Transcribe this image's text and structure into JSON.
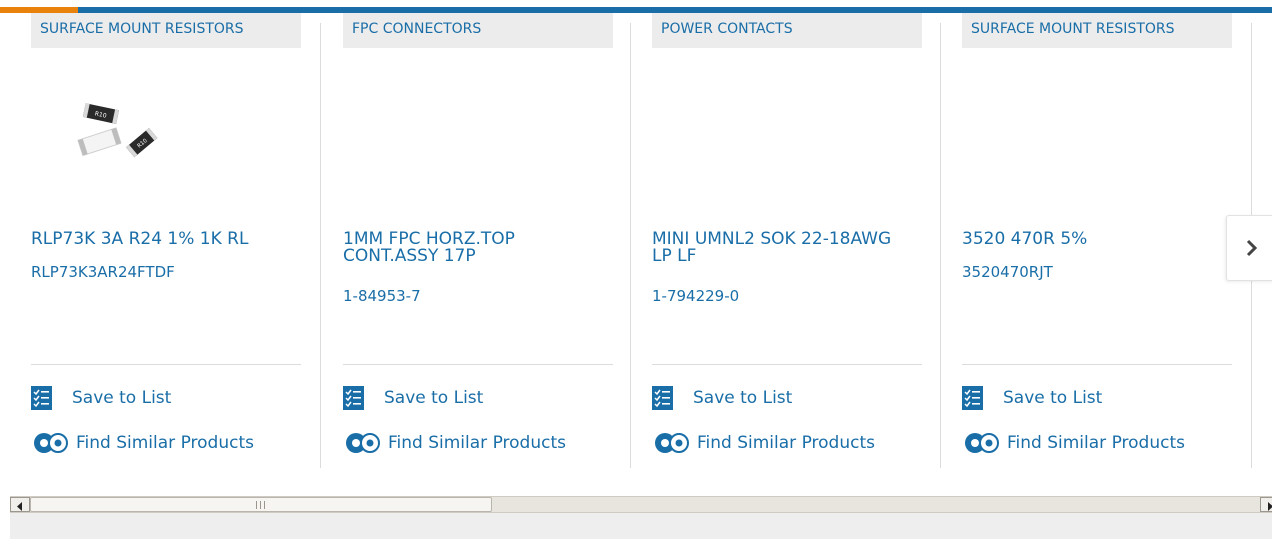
{
  "colors": {
    "accent_blue": "#1a6ea8",
    "accent_orange": "#e8820c",
    "category_bg": "#ececec"
  },
  "cards": [
    {
      "category": "SURFACE MOUNT RESISTORS",
      "title": "RLP73K 3A R24 1% 1K RL",
      "part_number": "RLP73K3AR24FTDF",
      "save_label": "Save to List",
      "similar_label": "Find Similar Products",
      "image_labels": [
        "R10",
        "R10"
      ]
    },
    {
      "category": "FPC CONNECTORS",
      "title": "1MM FPC HORZ.TOP CONT.ASSY 17P",
      "part_number": "1-84953-7",
      "save_label": "Save to List",
      "similar_label": "Find Similar Products"
    },
    {
      "category": "POWER CONTACTS",
      "title": "MINI UMNL2 SOK 22-18AWG LP LF",
      "part_number": "1-794229-0",
      "save_label": "Save to List",
      "similar_label": "Find Similar Products"
    },
    {
      "category": "SURFACE MOUNT RESISTORS",
      "title": "3520 470R 5%",
      "part_number": "3520470RJT",
      "save_label": "Save to List",
      "similar_label": "Find Similar Products"
    }
  ],
  "icons": {
    "save": "checklist-icon",
    "similar": "gears-icon",
    "next": "chevron-right-icon"
  }
}
